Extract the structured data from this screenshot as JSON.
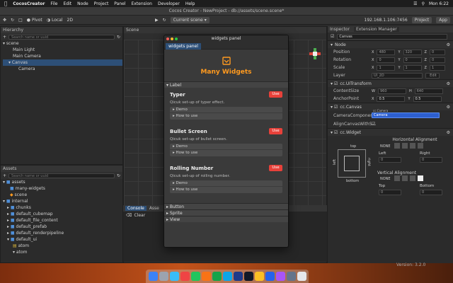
{
  "menubar": {
    "app": "CocosCreator",
    "items": [
      "File",
      "Edit",
      "Node",
      "Project",
      "Panel",
      "Extension",
      "Developer",
      "Help"
    ],
    "clock": "Mon 6:22",
    "date": "Jan 2"
  },
  "window": {
    "title": "Cocos Creator - NewProject - db://assets/scene.scene*"
  },
  "toolbar": {
    "pivot": "Pivot",
    "local": "Local",
    "mode": "2D",
    "scene_select": "Current scene",
    "ip": "192.168.1.106:7456",
    "project": "Project",
    "app": "App"
  },
  "hierarchy": {
    "title": "Hierarchy",
    "search_placeholder": "Search name or uuid",
    "nodes": [
      "scene",
      "Main Light",
      "Main Camera",
      "Canvas",
      "Camera"
    ]
  },
  "assets": {
    "title": "Assets",
    "search_placeholder": "Search name or uuid",
    "items": [
      "assets",
      "many-widgets",
      "scene",
      "internal",
      "chunks",
      "default_cubemap",
      "default_file_content",
      "default_prefab",
      "default_renderpipeline",
      "default_ui",
      "atom",
      "atom"
    ]
  },
  "scene": {
    "tab": "Scene"
  },
  "console": {
    "tab": "Console",
    "tab2": "Asse",
    "clear": "Clear"
  },
  "inspector": {
    "tab1": "Inspector",
    "tab2": "Extension Manager",
    "node_name": "Canvas",
    "node_section": "Node",
    "position": {
      "label": "Position",
      "x": "480",
      "y": "320",
      "z": "0"
    },
    "rotation": {
      "label": "Rotation",
      "x": "0",
      "y": "0",
      "z": "0"
    },
    "scale": {
      "label": "Scale",
      "x": "1",
      "y": "1",
      "z": "1"
    },
    "layer": {
      "label": "Layer",
      "value": "UI_2D",
      "edit": "Edit"
    },
    "uitransform": "cc.UITransform",
    "content_size": {
      "label": "ContentSize",
      "w": "960",
      "h": "640"
    },
    "anchor": {
      "label": "AnchorPoint",
      "x": "0.5",
      "y": "0.5"
    },
    "canvas": "cc.Canvas",
    "camera_component": {
      "label": "CameraComponent",
      "hint": "cc.Camera",
      "value": "Camera"
    },
    "align_canvas": "AlignCanvasWithS...",
    "widget": "cc.Widget",
    "horizontal_alignment": "Horizontal Alignment",
    "none": "NONE",
    "left": {
      "label": "Left",
      "value": "0"
    },
    "right": {
      "label": "Right",
      "value": "0"
    },
    "top": "top",
    "bottom": "bottom",
    "left_side": "left",
    "right_side": "right",
    "vertical_alignment": "Vertical Alignment",
    "top_field": {
      "label": "Top",
      "value": "0"
    },
    "bottom_field": {
      "label": "Bottom",
      "value": "0"
    },
    "version": "Version: 3.2.0"
  },
  "widgets_panel": {
    "window_title": "widgets panel",
    "tab": "widgets panel",
    "heading": "Many Widgets",
    "group_label": "Label",
    "widgets": [
      {
        "name": "Typer",
        "desc": "Qicuk set-up of typer effect.",
        "use": "Use",
        "demo": "Demo",
        "howto": "How to use"
      },
      {
        "name": "Bullet Screen",
        "desc": "Qicuk set-up of bullet screen.",
        "use": "Use",
        "demo": "Demo",
        "howto": "How to use"
      },
      {
        "name": "Rolling Number",
        "desc": "Qicuk set-up of rolling number.",
        "use": "Use",
        "demo": "Demo",
        "howto": "How to use"
      }
    ],
    "groups": [
      "Button",
      "Sprite",
      "View"
    ]
  },
  "colors": {
    "accent": "#ff9a1f",
    "use_button": "#e8413a",
    "selection": "#2d4f77"
  }
}
